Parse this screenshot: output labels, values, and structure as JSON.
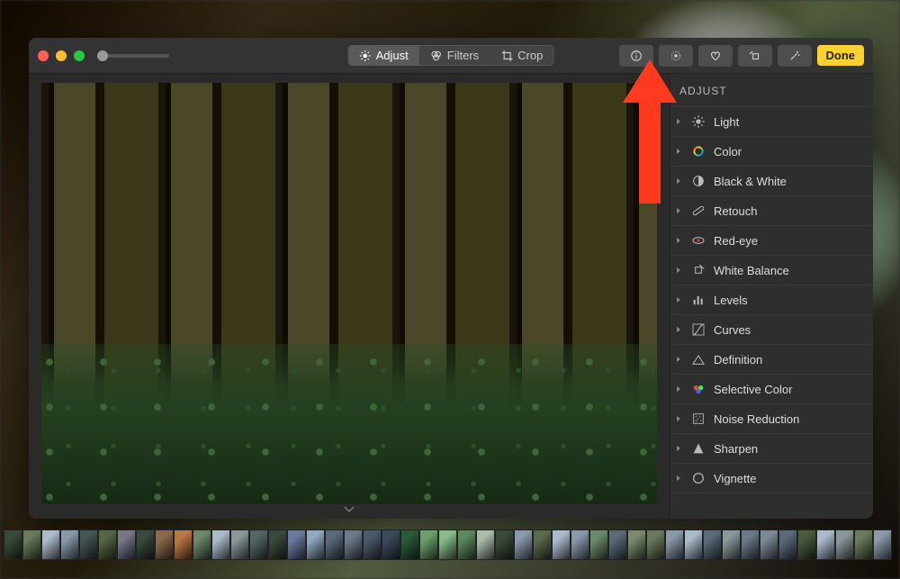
{
  "toolbar": {
    "tabs": {
      "adjust": "Adjust",
      "filters": "Filters",
      "crop": "Crop"
    },
    "done": "Done"
  },
  "panel": {
    "title": "ADJUST",
    "items": [
      {
        "label": "Light",
        "icon": "light-icon"
      },
      {
        "label": "Color",
        "icon": "color-ring-icon"
      },
      {
        "label": "Black & White",
        "icon": "contrast-icon"
      },
      {
        "label": "Retouch",
        "icon": "bandage-icon"
      },
      {
        "label": "Red-eye",
        "icon": "redeye-icon"
      },
      {
        "label": "White Balance",
        "icon": "dropper-icon"
      },
      {
        "label": "Levels",
        "icon": "levels-icon"
      },
      {
        "label": "Curves",
        "icon": "curves-icon"
      },
      {
        "label": "Definition",
        "icon": "definition-icon"
      },
      {
        "label": "Selective Color",
        "icon": "selective-color-icon"
      },
      {
        "label": "Noise Reduction",
        "icon": "noise-icon"
      },
      {
        "label": "Sharpen",
        "icon": "sharpen-icon"
      },
      {
        "label": "Vignette",
        "icon": "vignette-icon"
      }
    ]
  },
  "thumbs": [
    "#3a4a3a",
    "#6a7a5a",
    "#aabbcc",
    "#8899aa",
    "#445555",
    "#556644",
    "#777788",
    "#3a4a3a",
    "#8a6a4a",
    "#bb7744",
    "#6a8a6a",
    "#aabbcc",
    "#889999",
    "#556666",
    "#3a4a3a",
    "#6a7aa0",
    "#8fa8c0",
    "#5a6a7a",
    "#6a7a8a",
    "#4a5a6a",
    "#3a4a5a",
    "#2a5a3a",
    "#6aa06a",
    "#88bb88",
    "#5a8a5a",
    "#aabbaa",
    "#3a4a3a",
    "#8899aa",
    "#5a6a4a",
    "#aabbcc",
    "#8899aa",
    "#6a8a6a",
    "#5a6a7a",
    "#7a8a6a",
    "#6a7a5a",
    "#8899aa",
    "#aabbcc",
    "#5a6a7a",
    "#889999",
    "#6a7a8a",
    "#7a8a9a",
    "#5a6a7a",
    "#4a5a3a",
    "#aabbcc",
    "#889999",
    "#6a7a5a",
    "#8899aa"
  ]
}
